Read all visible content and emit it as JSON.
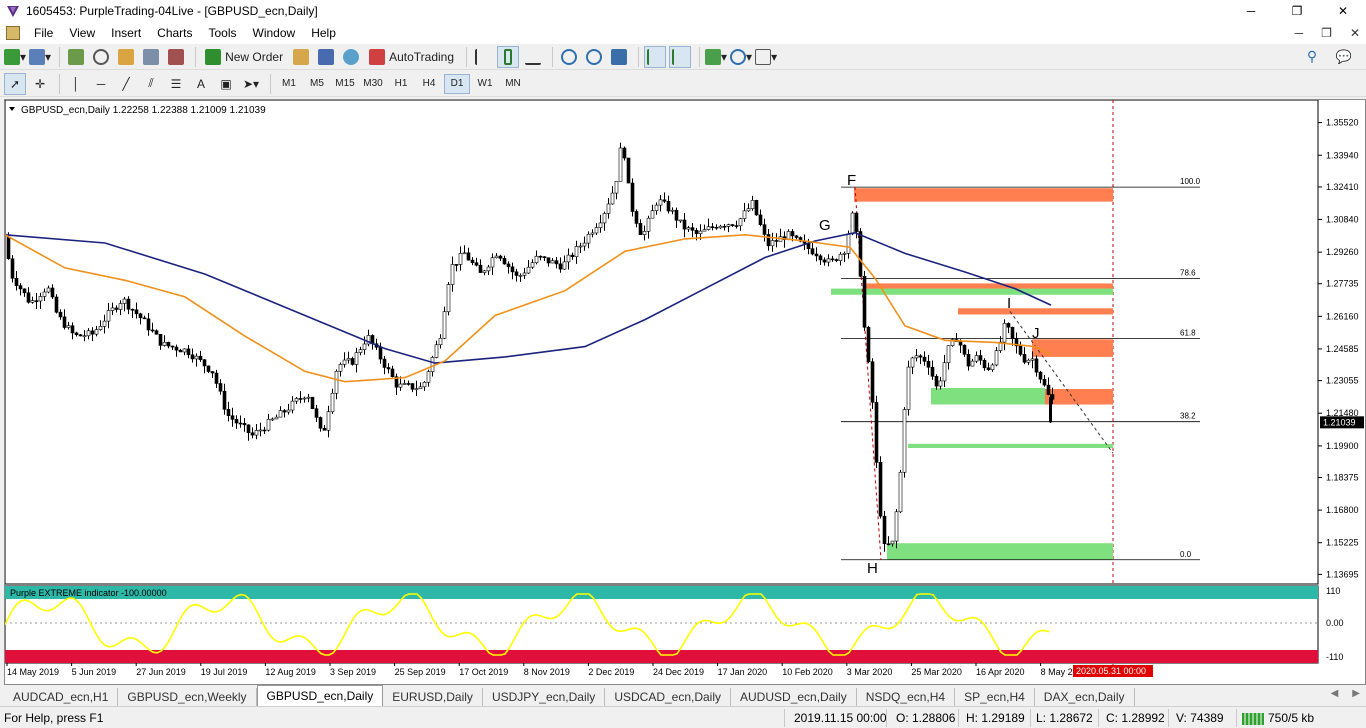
{
  "window": {
    "title": "1605453: PurpleTrading-04Live - [GBPUSD_ecn,Daily]",
    "minimize": "─",
    "maximize": "❐",
    "close": "✕"
  },
  "menu": {
    "items": [
      "File",
      "View",
      "Insert",
      "Charts",
      "Tools",
      "Window",
      "Help"
    ]
  },
  "toolbar": {
    "new_order": "New Order",
    "autotrading": "AutoTrading"
  },
  "tools": {
    "text_tool": "A"
  },
  "timeframes": {
    "items": [
      "M1",
      "M5",
      "M15",
      "M30",
      "H1",
      "H4",
      "D1",
      "W1",
      "MN"
    ],
    "active": "D1"
  },
  "chart": {
    "header": "GBPUSD_ecn,Daily  1.22258 1.22388 1.21009 1.21039",
    "symbol": "GBPUSD_ecn",
    "timeframe": "Daily",
    "ohlc": {
      "open": 1.22258,
      "high": 1.22388,
      "low": 1.21009,
      "close": 1.21039
    },
    "current_price_label": "1.21039",
    "price_axis": [
      "1.35520",
      "1.33940",
      "1.32410",
      "1.30840",
      "1.29260",
      "1.27735",
      "1.26160",
      "1.24585",
      "1.23055",
      "1.21480",
      "1.19900",
      "1.18375",
      "1.16800",
      "1.15225",
      "1.13695"
    ],
    "time_axis": [
      "14 May 2019",
      "5 Jun 2019",
      "27 Jun 2019",
      "19 Jul 2019",
      "12 Aug 2019",
      "3 Sep 2019",
      "25 Sep 2019",
      "17 Oct 2019",
      "8 Nov 2019",
      "2 Dec 2019",
      "24 Dec 2019",
      "17 Jan 2020",
      "10 Feb 2020",
      "3 Mar 2020",
      "25 Mar 2020",
      "16 Apr 2020",
      "8 May 202"
    ],
    "time_cursor_label": "2020.05.31 00:00",
    "fib_levels": [
      "100.0",
      "78.6",
      "61.8",
      "38.2",
      "0.0"
    ],
    "wave_labels": [
      "F",
      "G",
      "H",
      "I",
      "J"
    ],
    "colors": {
      "bull_candle": "#ffffff",
      "bear_candle": "#000000",
      "ma_fast": "#f0901a",
      "ma_slow": "#1a237e",
      "supply_zone": "#ff7f50",
      "demand_zone": "#7fe07f",
      "price_label_bg": "#000000",
      "cursor_label_bg": "#e00000"
    }
  },
  "indicator": {
    "label": "Purple EXTREME indicator -100.00000",
    "levels": [
      "110",
      "0.00",
      "-110"
    ],
    "colors": {
      "upper_band": "#2eb8a8",
      "lower_band": "#e0103a",
      "line": "#ffff00"
    }
  },
  "tabs": {
    "items": [
      "AUDCAD_ecn,H1",
      "GBPUSD_ecn,Weekly",
      "GBPUSD_ecn,Daily",
      "EURUSD,Daily",
      "USDJPY_ecn,Daily",
      "USDCAD_ecn,Daily",
      "AUDUSD_ecn,Daily",
      "NSDQ_ecn,H4",
      "SP_ecn,H4",
      "DAX_ecn,Daily"
    ],
    "active": "GBPUSD_ecn,Daily"
  },
  "status": {
    "help": "For Help, press F1",
    "datetime": "2019.11.15 00:00",
    "open": "O: 1.28806",
    "high": "H: 1.29189",
    "low": "L: 1.28672",
    "close": "C: 1.28992",
    "volume": "V: 74389",
    "traffic": "750/5 kb"
  }
}
